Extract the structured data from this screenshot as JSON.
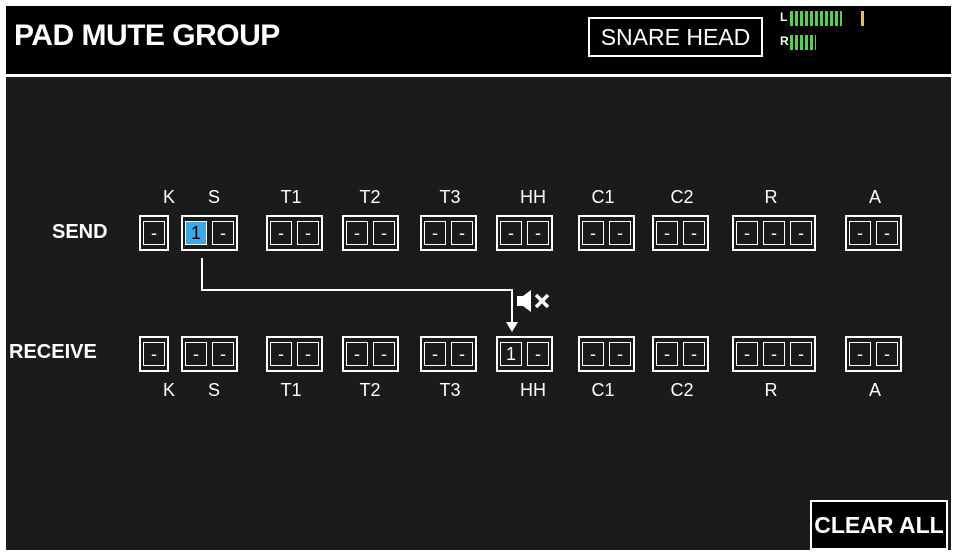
{
  "header": {
    "title": "PAD MUTE GROUP",
    "instrument": "SNARE HEAD",
    "meter": {
      "left_label": "L",
      "right_label": "R",
      "left_level": 0.6,
      "left_peak": 0.83,
      "right_level": 0.3
    }
  },
  "send": {
    "label": "SEND",
    "pads": [
      "K",
      "S",
      "T1",
      "T2",
      "T3",
      "HH",
      "C1",
      "C2",
      "R",
      "A"
    ],
    "groups": [
      [
        "-"
      ],
      [
        "1",
        "-"
      ],
      [
        "-",
        "-"
      ],
      [
        "-",
        "-"
      ],
      [
        "-",
        "-"
      ],
      [
        "-",
        "-"
      ],
      [
        "-",
        "-"
      ],
      [
        "-",
        "-"
      ],
      [
        "-",
        "-",
        "-"
      ],
      [
        "-",
        "-"
      ]
    ]
  },
  "receive": {
    "label": "RECEIVE",
    "pads": [
      "K",
      "S",
      "T1",
      "T2",
      "T3",
      "HH",
      "C1",
      "C2",
      "R",
      "A"
    ],
    "groups": [
      [
        "-"
      ],
      [
        "-",
        "-"
      ],
      [
        "-",
        "-"
      ],
      [
        "-",
        "-"
      ],
      [
        "-",
        "-"
      ],
      [
        "1",
        "-"
      ],
      [
        "-",
        "-"
      ],
      [
        "-",
        "-"
      ],
      [
        "-",
        "-",
        "-"
      ],
      [
        "-",
        "-"
      ]
    ]
  },
  "mute_icon": "speaker-mute-icon",
  "clear_all_label": "CLEAR ALL",
  "colors": {
    "selected": "#3aa8e6",
    "meter": "#4ed44e",
    "peak": "#f2c230",
    "background": "#1b1b1b"
  }
}
